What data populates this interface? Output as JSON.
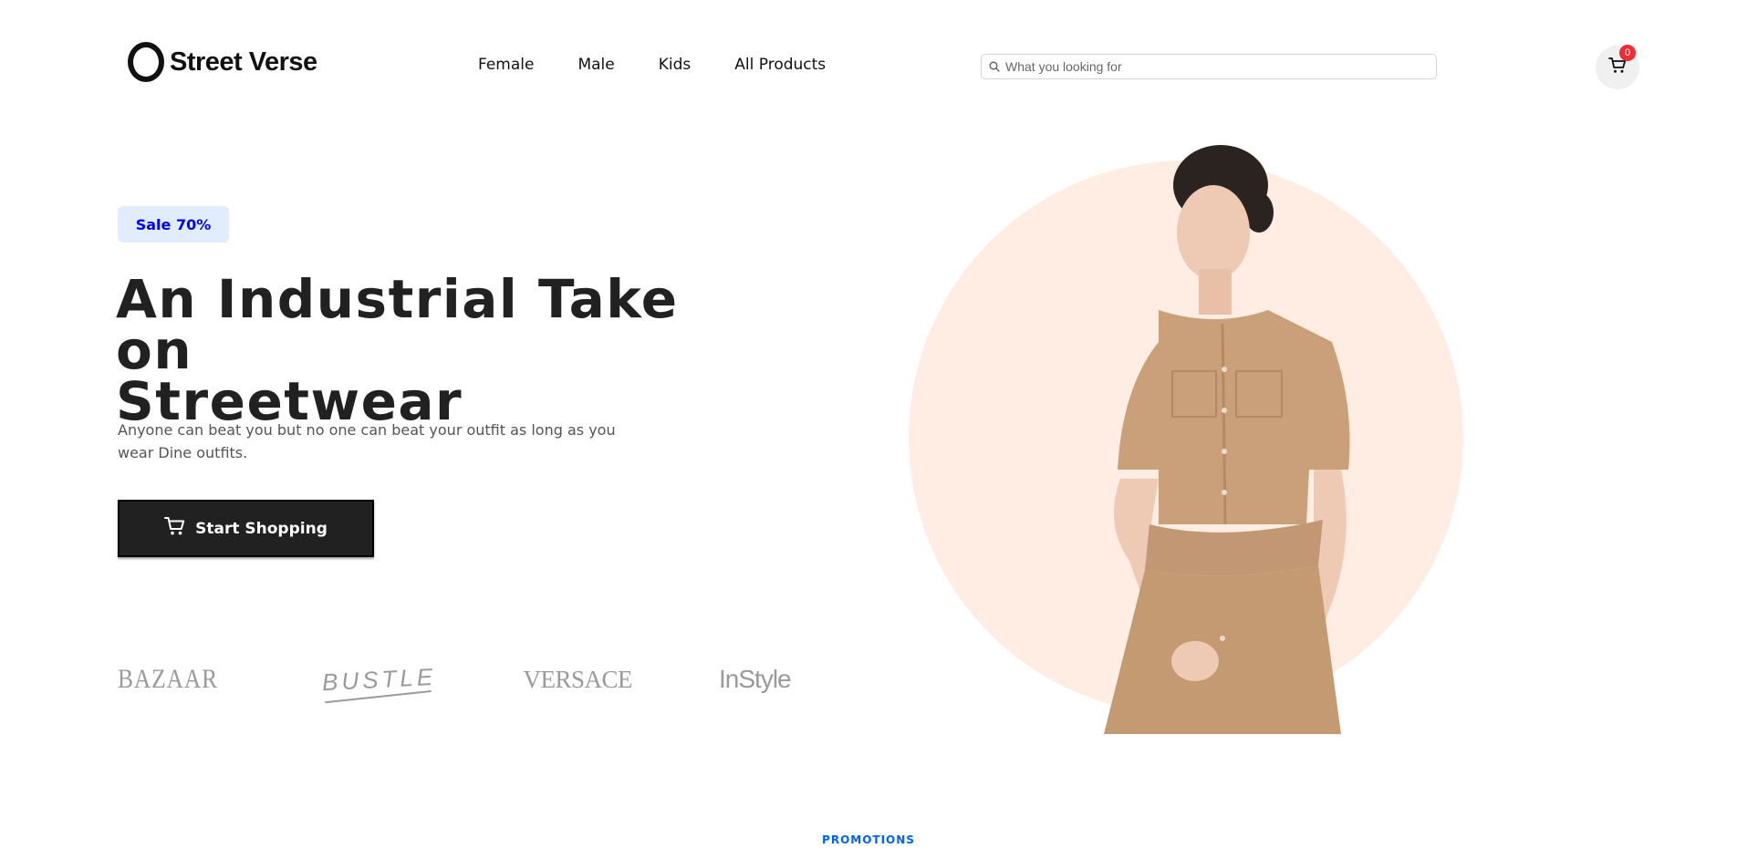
{
  "header": {
    "logo_text": "Street Verse",
    "nav": [
      "Female",
      "Male",
      "Kids",
      "All Products"
    ],
    "search": {
      "placeholder": "What you looking for",
      "value": ""
    },
    "cart_count": "0"
  },
  "hero": {
    "badge": "Sale 70%",
    "title_line1": "An Industrial Take on",
    "title_line2": "Streetwear",
    "subtitle_line1": "Anyone can beat you but no one can beat your outfit as long as you",
    "subtitle_line2": "wear Dine outfits.",
    "button_label": "Start Shopping",
    "brands": [
      "BAZAAR",
      "BUSTLE",
      "VERSACE",
      "InStyle"
    ]
  },
  "promotions": {
    "label": "PROMOTIONS"
  },
  "colors": {
    "accent_blue": "#0062f5",
    "badge_bg": "#e1edff",
    "badge_text": "#0000ff",
    "hero_circle": "#ffece3",
    "cart_badge": "#f02d34",
    "button_bg": "#212121"
  },
  "icons": [
    "search-icon",
    "cart-icon",
    "cart-button-icon"
  ]
}
